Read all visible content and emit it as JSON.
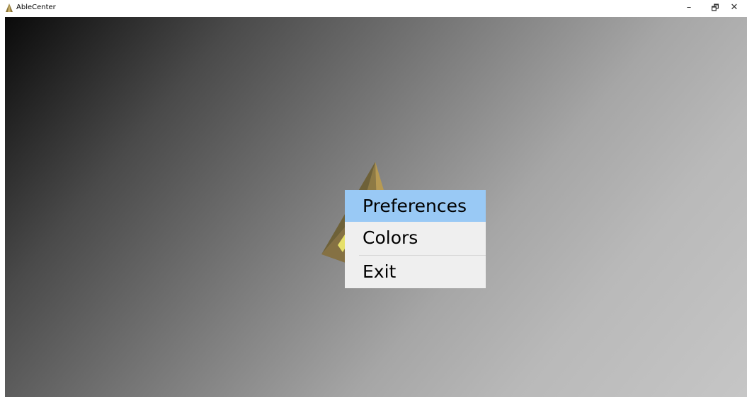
{
  "window": {
    "title": "AbleCenter",
    "controls": {
      "minimize": "–",
      "restore": "🗗",
      "close": "✕"
    }
  },
  "context_menu": {
    "items": [
      {
        "label": "Preferences",
        "selected": true
      },
      {
        "label": "Colors",
        "selected": false
      },
      {
        "label": "Exit",
        "selected": false
      }
    ]
  },
  "colors": {
    "menu_background": "#efefef",
    "menu_highlight": "#99c9f5",
    "pyramid_gold": "#a08a4e",
    "pyramid_accent": "#e6e06a"
  }
}
